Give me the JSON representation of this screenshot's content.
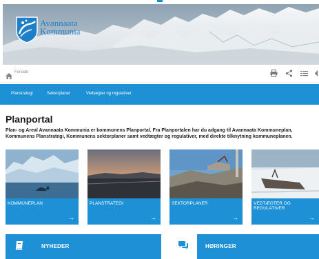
{
  "header": {
    "logo_line1": "Avannaata",
    "logo_line2": "Kommunia"
  },
  "breadcrumb": {
    "home_label": "Forside"
  },
  "toolbar_icons": [
    "print-icon",
    "share-icon",
    "list-icon",
    "font-size-icon"
  ],
  "nav": {
    "items": [
      {
        "label": "Planstrategi"
      },
      {
        "label": "Sektorplaner"
      },
      {
        "label": "Vedtægter og regulativer"
      }
    ]
  },
  "main": {
    "title": "Planportal",
    "intro": "Plan- og Areal Avannaata Kommunia er kommunens Planportal. Fra Planportalen har du adgang til Avannaata Kommuneplan, Kommunens Planstrategi, Kommunens sektorplaner samt vedtægter og regulativer, med direkte tilknytning kommuneplanen."
  },
  "cards": [
    {
      "label": "KOMMUNEPLAN"
    },
    {
      "label": "PLANSTRATEGI"
    },
    {
      "label": "SEKTORPLANER"
    },
    {
      "label": "VEDTÆGTER OG REGULATIVER"
    }
  ],
  "bottom": {
    "news_label": "NYHEDER",
    "hearings_label": "HØRINGER"
  },
  "colors": {
    "accent": "#1e90d6",
    "logo_blue": "#1e7fc9"
  }
}
